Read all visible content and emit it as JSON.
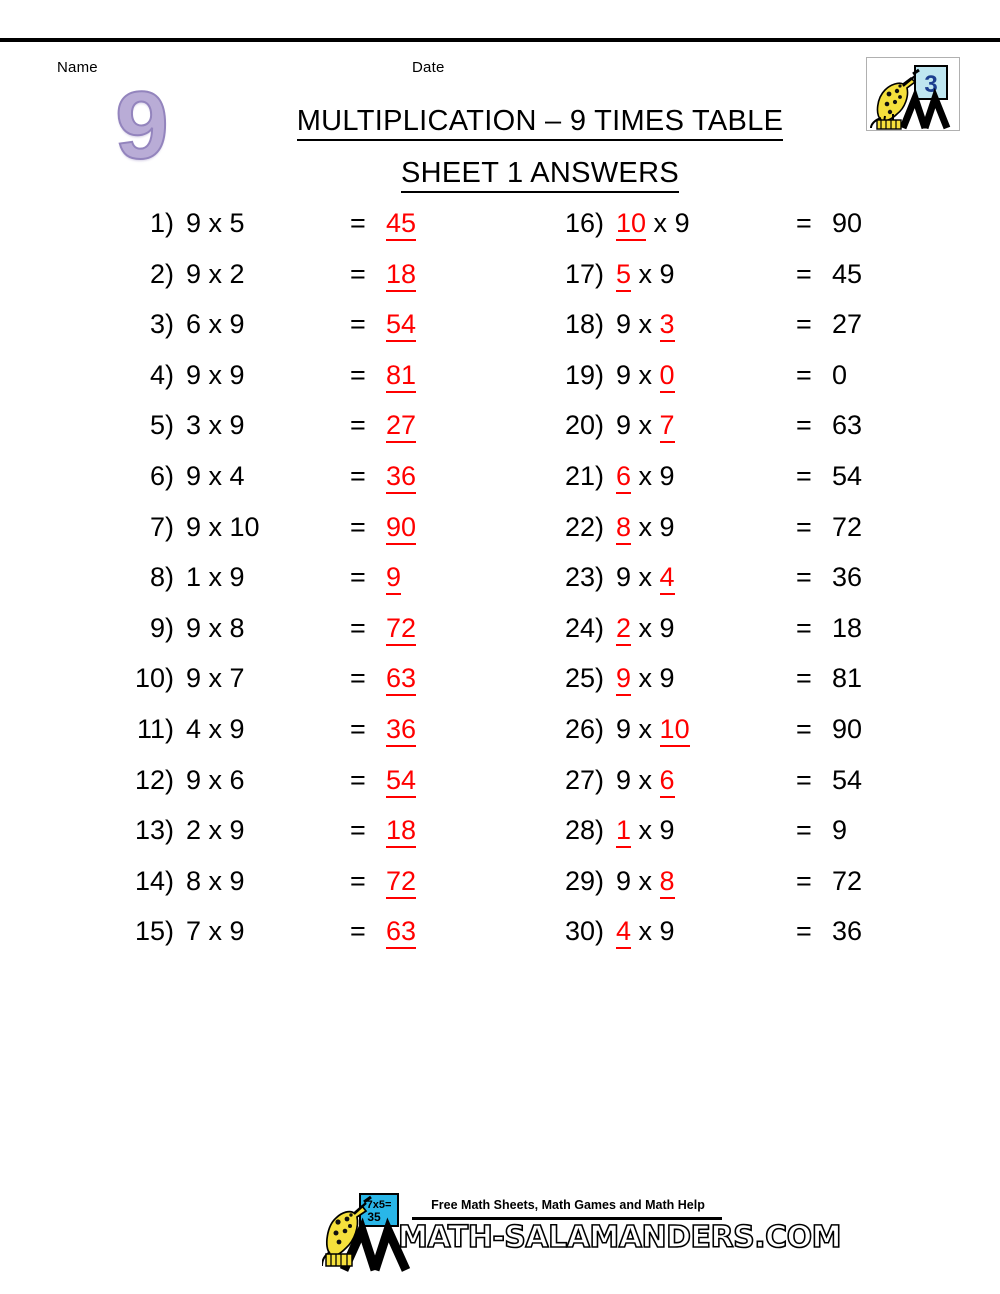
{
  "header": {
    "name_label": "Name",
    "date_label": "Date",
    "big_numeral": "9",
    "logo_grade": "3",
    "logo_icon": "salamander-grade-badge-icon"
  },
  "title": {
    "main": "MULTIPLICATION – 9 TIMES TABLE",
    "sub": "SHEET 1 ANSWERS"
  },
  "colors": {
    "answer_red": "#ff0000",
    "numeral_purple": "#b9acd6",
    "numeral_outline": "#9384bd",
    "board_blue": "#29b6e8",
    "salamander_yellow": "#f5e03c",
    "text_black": "#000000"
  },
  "equals_sign": "=",
  "problems_left": [
    {
      "index": "1)",
      "expr": "9 x 5",
      "answer": "45",
      "answer_style": "red"
    },
    {
      "index": "2)",
      "expr": "9 x 2",
      "answer": "18",
      "answer_style": "red"
    },
    {
      "index": "3)",
      "expr": "6 x 9",
      "answer": "54",
      "answer_style": "red"
    },
    {
      "index": "4)",
      "expr": "9 x 9",
      "answer": "81",
      "answer_style": "red"
    },
    {
      "index": "5)",
      "expr": "3 x 9",
      "answer": "27",
      "answer_style": "red"
    },
    {
      "index": "6)",
      "expr": "9 x 4",
      "answer": "36",
      "answer_style": "red"
    },
    {
      "index": "7)",
      "expr": "9 x 10",
      "answer": "90",
      "answer_style": "red"
    },
    {
      "index": "8)",
      "expr": "1 x 9",
      "answer": "9",
      "answer_style": "red"
    },
    {
      "index": "9)",
      "expr": "9 x 8",
      "answer": "72",
      "answer_style": "red"
    },
    {
      "index": "10)",
      "expr": "9 x 7",
      "answer": "63",
      "answer_style": "red"
    },
    {
      "index": "11)",
      "expr": "4 x 9",
      "answer": "36",
      "answer_style": "red"
    },
    {
      "index": "12)",
      "expr": "9 x 6",
      "answer": "54",
      "answer_style": "red"
    },
    {
      "index": "13)",
      "expr": "2 x 9",
      "answer": "18",
      "answer_style": "red"
    },
    {
      "index": "14)",
      "expr": "8 x 9",
      "answer": "72",
      "answer_style": "red"
    },
    {
      "index": "15)",
      "expr": "7 x 9",
      "answer": "63",
      "answer_style": "red"
    }
  ],
  "problems_right": [
    {
      "index": "16)",
      "operand_a": "10",
      "operand_b": "9",
      "filled": "a",
      "answer": "90",
      "answer_style": "black"
    },
    {
      "index": "17)",
      "operand_a": "5",
      "operand_b": "9",
      "filled": "a",
      "answer": "45",
      "answer_style": "black"
    },
    {
      "index": "18)",
      "operand_a": "9",
      "operand_b": "3",
      "filled": "b",
      "answer": "27",
      "answer_style": "black"
    },
    {
      "index": "19)",
      "operand_a": "9",
      "operand_b": "0",
      "filled": "b",
      "answer": "0",
      "answer_style": "black"
    },
    {
      "index": "20)",
      "operand_a": "9",
      "operand_b": "7",
      "filled": "b",
      "answer": "63",
      "answer_style": "black"
    },
    {
      "index": "21)",
      "operand_a": "6",
      "operand_b": "9",
      "filled": "a",
      "answer": "54",
      "answer_style": "black"
    },
    {
      "index": "22)",
      "operand_a": "8",
      "operand_b": "9",
      "filled": "a",
      "answer": "72",
      "answer_style": "black"
    },
    {
      "index": "23)",
      "operand_a": "9",
      "operand_b": "4",
      "filled": "b",
      "answer": "36",
      "answer_style": "black"
    },
    {
      "index": "24)",
      "operand_a": "2",
      "operand_b": "9",
      "filled": "a",
      "answer": "18",
      "answer_style": "black"
    },
    {
      "index": "25)",
      "operand_a": "9",
      "operand_b": "9",
      "filled": "a",
      "answer": "81",
      "answer_style": "black"
    },
    {
      "index": "26)",
      "operand_a": "9",
      "operand_b": "10",
      "filled": "b",
      "answer": "90",
      "answer_style": "black"
    },
    {
      "index": "27)",
      "operand_a": "9",
      "operand_b": "6",
      "filled": "b",
      "answer": "54",
      "answer_style": "black"
    },
    {
      "index": "28)",
      "operand_a": "1",
      "operand_b": "9",
      "filled": "a",
      "answer": "9",
      "answer_style": "black"
    },
    {
      "index": "29)",
      "operand_a": "9",
      "operand_b": "8",
      "filled": "b",
      "answer": "72",
      "answer_style": "black"
    },
    {
      "index": "30)",
      "operand_a": "4",
      "operand_b": "9",
      "filled": "a",
      "answer": "36",
      "answer_style": "black"
    }
  ],
  "multiply_symbol": "x",
  "footer": {
    "tagline": "Free Math Sheets, Math Games and Math Help",
    "url": "MATH-SALAMANDERS.COM",
    "logo_icon": "salamander-chalkboard-icon",
    "board_text_line1": "7x5=",
    "board_text_line2": "35"
  }
}
